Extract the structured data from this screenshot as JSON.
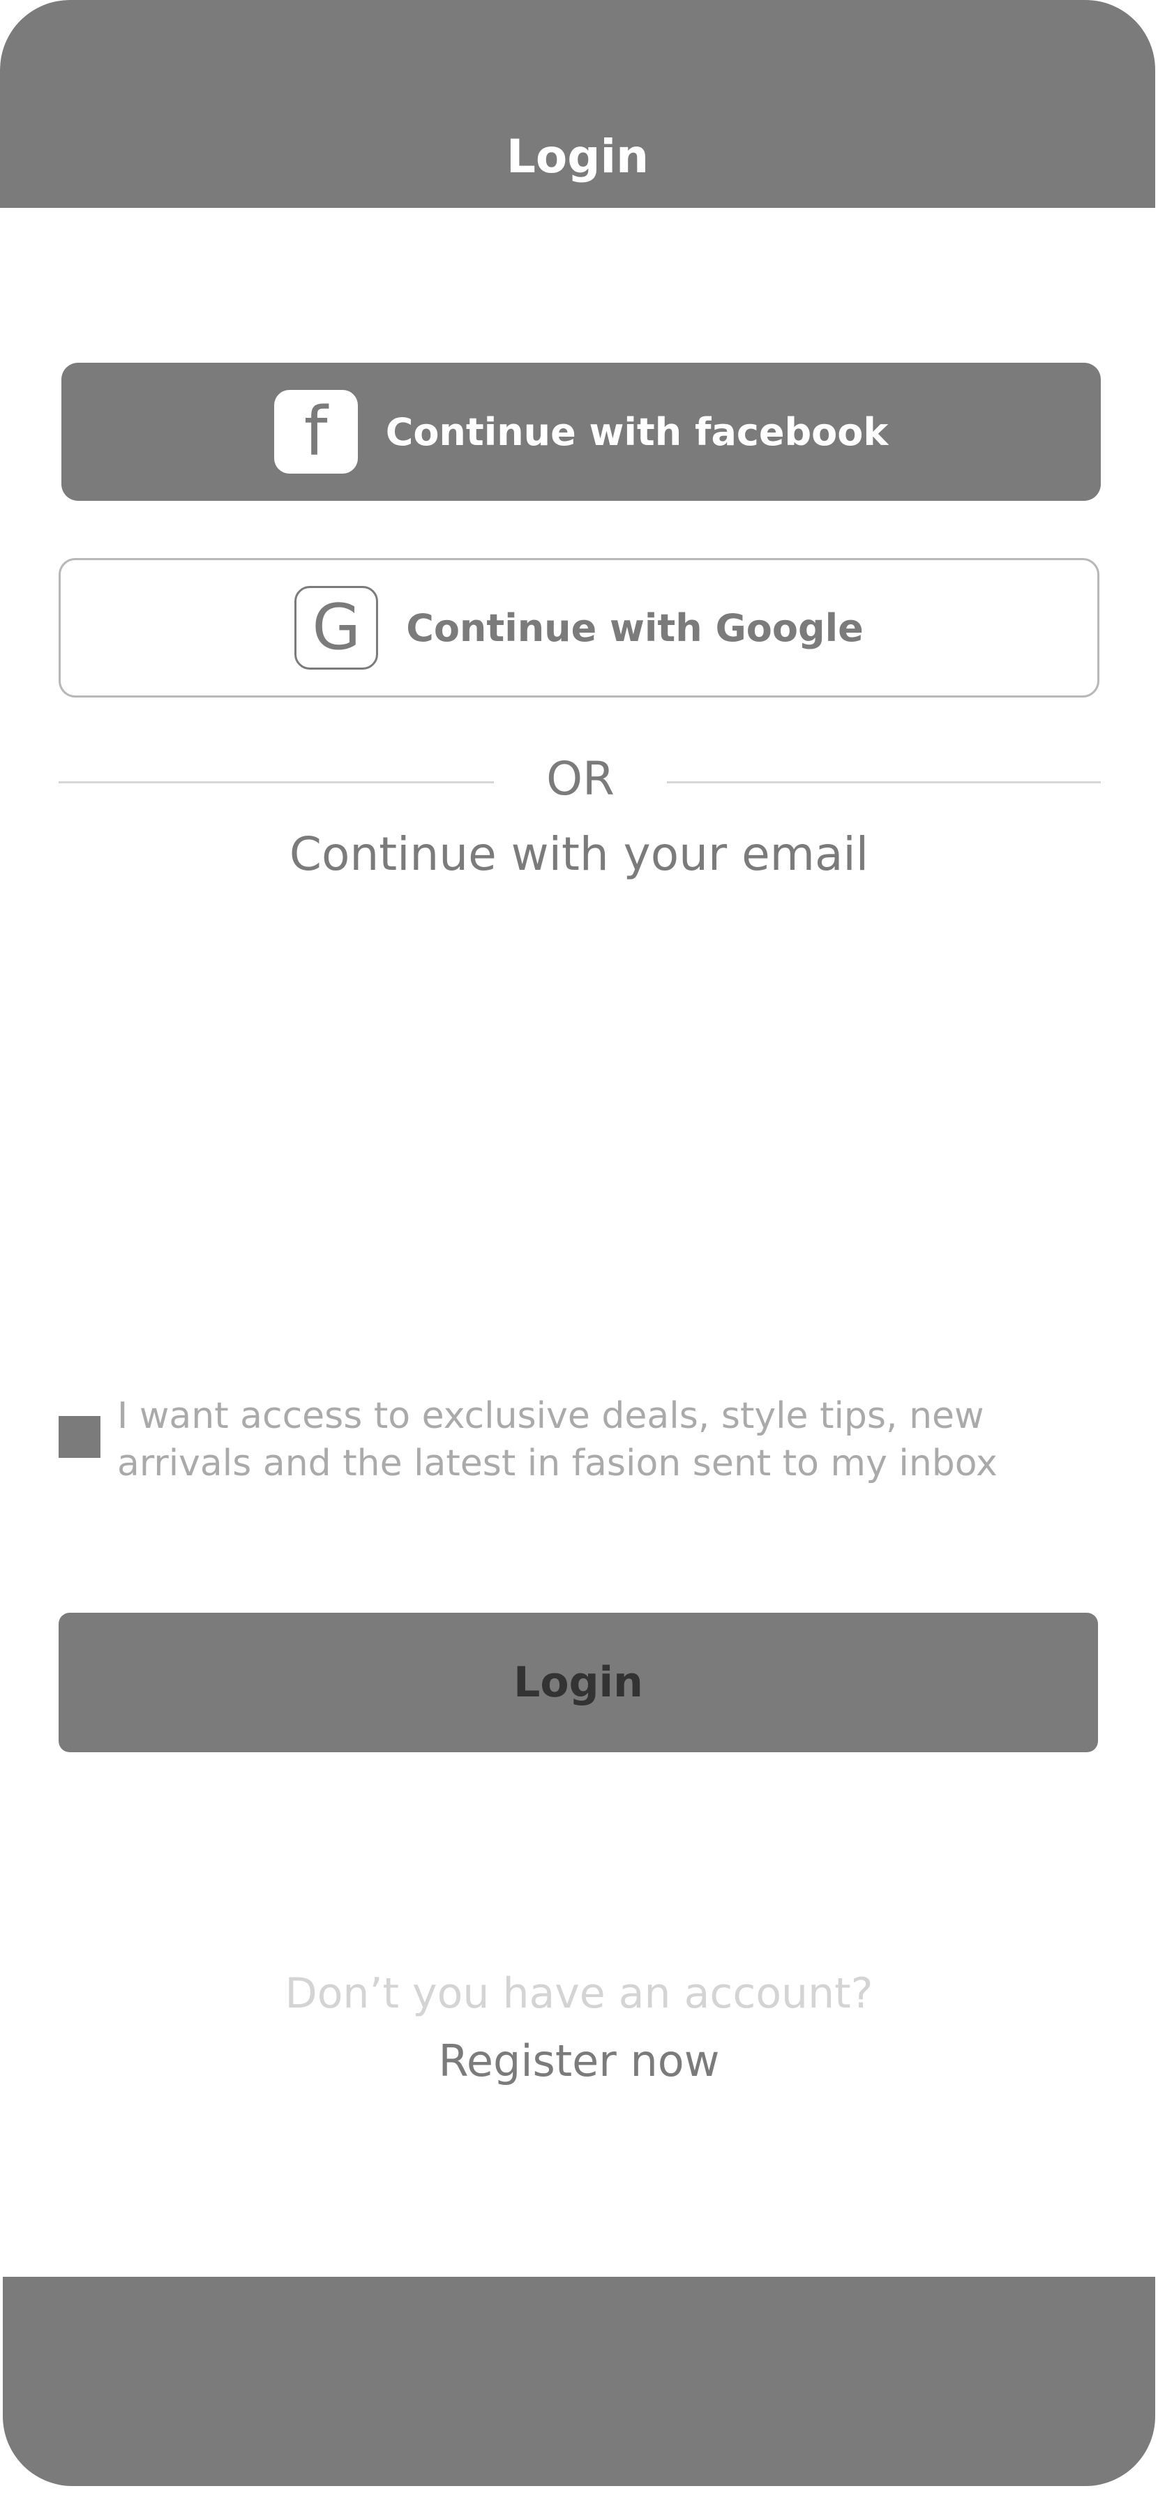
{
  "header": {
    "title": "Login"
  },
  "social": {
    "facebook": {
      "icon_glyph": "f",
      "icon_name": "facebook-icon",
      "label": "Continue with facebook"
    },
    "google": {
      "icon_glyph": "G",
      "icon_name": "google-icon",
      "label": "Continue with Google"
    }
  },
  "divider": {
    "text": "OR"
  },
  "email_section": {
    "subtitle": "Continue with your email"
  },
  "newsletter": {
    "checked": true,
    "label": "I want access to exclusive deals,  style tips, new arrivals and the latest in fasion sent to my inbox"
  },
  "login_button": {
    "label": "Login"
  },
  "register": {
    "prompt": "Don’t you have an account?",
    "link": "Register now"
  },
  "colors": {
    "primary_gray": "#7b7b7b",
    "border_gray": "#b8b8b8",
    "muted_text": "#aaaaaa",
    "faint_text": "#d4d4d4",
    "white": "#ffffff"
  }
}
